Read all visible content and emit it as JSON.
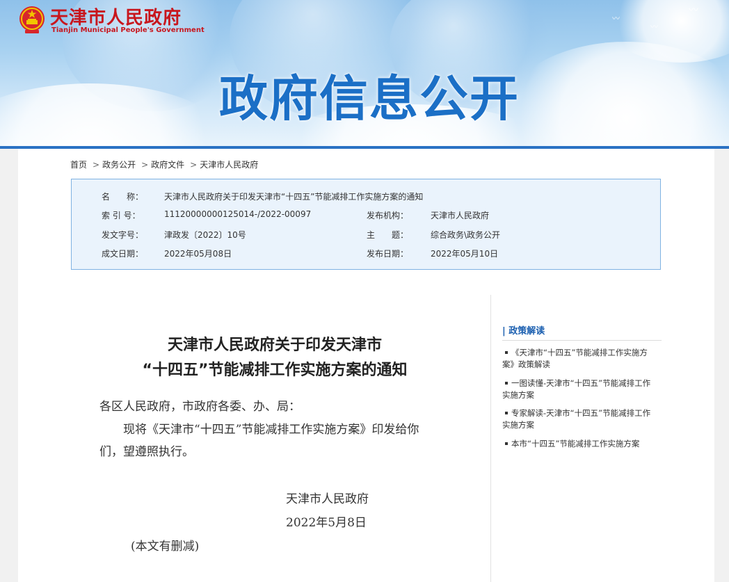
{
  "header": {
    "site_name": "天津市人民政府",
    "site_name_en": "Tianjin Municipal People's Government",
    "banner_title": "政府信息公开"
  },
  "breadcrumb": [
    "首页",
    "政务公开",
    "政府文件",
    "天津市人民政府"
  ],
  "meta": {
    "name_label": "名　　称：",
    "name_value": "天津市人民政府关于印发天津市“十四五”节能减排工作实施方案的通知",
    "index_label": "索 引 号：",
    "index_value": "11120000000125014-/2022-00097",
    "issuer_label": "发布机构：",
    "issuer_value": "天津市人民政府",
    "docno_label": "发文字号：",
    "docno_value": "津政发〔2022〕10号",
    "topic_label": "主　　题：",
    "topic_value": "综合政务\\政务公开",
    "written_label": "成文日期：",
    "written_value": "2022年05月08日",
    "published_label": "发布日期：",
    "published_value": "2022年05月10日"
  },
  "article": {
    "title_line1": "天津市人民政府关于印发天津市",
    "title_line2": "“十四五”节能减排工作实施方案的通知",
    "salutation": "各区人民政府，市政府各委、办、局：",
    "body_line1": "现将《天津市“十四五”节能减排工作实施方案》印发给你",
    "body_line2": "们，望遵照执行。",
    "signature": "天津市人民政府",
    "date": "2022年5月8日",
    "note": "(本文有删减)"
  },
  "sidebar": {
    "heading": "| 政策解读",
    "items": [
      {
        "line1": "《天津市“十四五”节能减排工作实施方",
        "line2": "案》政策解读"
      },
      {
        "line1": "一图读懂-天津市“十四五”节能减排工作",
        "line2": "实施方案"
      },
      {
        "line1": "专家解读-天津市“十四五”节能减排工作",
        "line2": "实施方案"
      },
      {
        "line1": "本市“十四五”节能减排工作实施方案",
        "line2": ""
      }
    ]
  },
  "colors": {
    "brand_red": "#c8161d",
    "banner_blue": "#1b6fc6",
    "accent_blue": "#2a72c4",
    "meta_bg": "#eaf3fc"
  }
}
